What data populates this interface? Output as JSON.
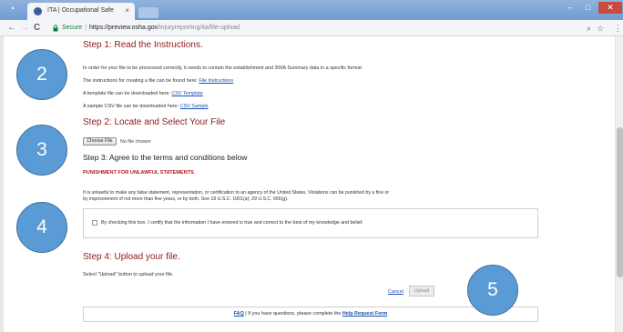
{
  "browser": {
    "tab_title": "ITA | Occupational Safe",
    "tab_close": "×",
    "back": "←",
    "forward": "→",
    "reload": "C",
    "secure_label": "Secure",
    "url_host": "https://preview.osha.gov",
    "url_path": "/injuryreporting/ita/file-upload",
    "zoom_icon": "⌕",
    "star_icon": "☆",
    "menu_icon": "⋮"
  },
  "page": {
    "step1_title": "Step 1: Read the Instructions.",
    "step1_text": "In order for your file to be processed correctly, it needs to contain the establishment and 300A Summary data in a specific format.",
    "instructions_text": "The instructions for creating a file can be found here:",
    "instructions_link": "File Instructions",
    "template_text": "A template file can be downloaded here:",
    "template_link": "CSV Template",
    "sample_text": "A sample CSV file can be downloaded here:",
    "sample_link": "CSV Sample",
    "step2_title": "Step 2: Locate and Select Your File",
    "choose_file_label": "Choose File",
    "no_file_text": "No file chosen",
    "step3_title": "Step 3: Agree to the terms and conditions below",
    "warning_heading": "PUNISHMENT FOR UNLAWFUL STATEMENTS",
    "warning_line1": "It is unlawful to make any false statement, representation, or certification to an agency of the United States. Violations can be punished by a fine or",
    "warning_line2": "by imprisonment of not more than five years, or by both. See 18 U.S.C. 1001(a); 29 U.S.C. 666(g).",
    "certify_text": "By checking this box, I certify that the information I have entered is true and correct to the best of my knowledge and belief.",
    "step4_title": "Step 4: Upload your file.",
    "step4_text": "Select \"Upload\" button to upload your file.",
    "cancel_label": "Cancel",
    "upload_label": "Upload",
    "footer_faq": "FAQ",
    "footer_text": "| If you have questions, please complete the",
    "footer_link": "Help Request Form"
  },
  "callouts": [
    "2",
    "3",
    "4",
    "5"
  ],
  "colors": {
    "callout_fill": "#5b9bd5",
    "heading_red": "#8b1a1a",
    "link_blue": "#1a4fb5"
  }
}
